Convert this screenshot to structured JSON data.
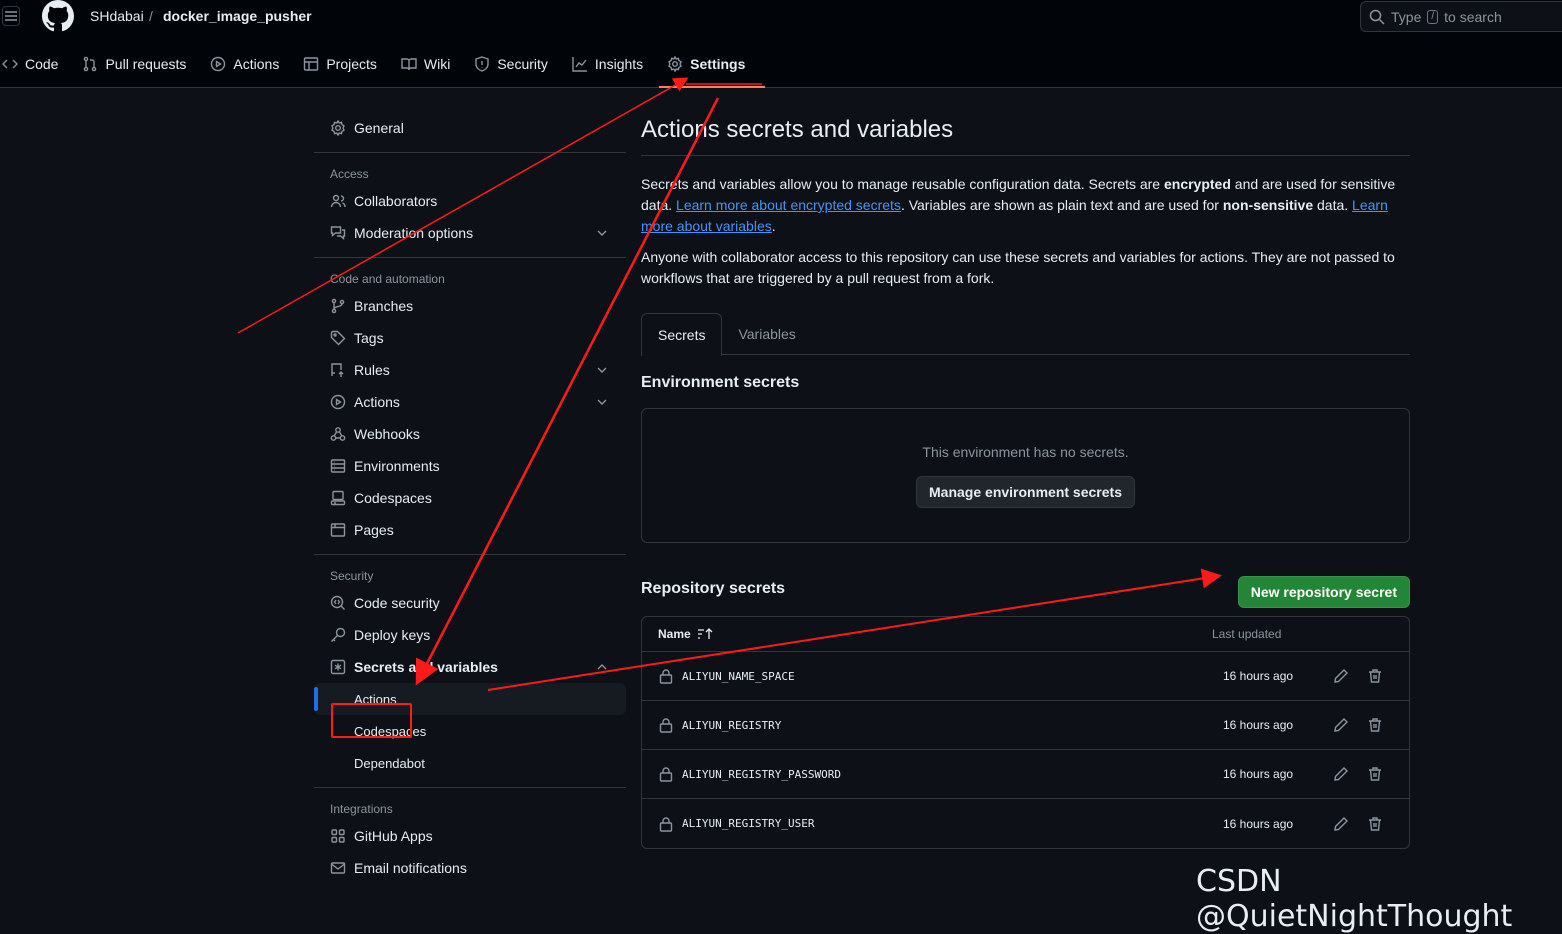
{
  "header": {
    "owner": "SHdabai",
    "separator": "/",
    "repo": "docker_image_pusher",
    "search": {
      "before": "Type",
      "key": "/",
      "after": "to search"
    }
  },
  "repo_tabs": [
    {
      "label": "Code",
      "icon": "code-icon"
    },
    {
      "label": "Pull requests",
      "icon": "pull-request-icon"
    },
    {
      "label": "Actions",
      "icon": "play-icon"
    },
    {
      "label": "Projects",
      "icon": "table-icon"
    },
    {
      "label": "Wiki",
      "icon": "book-icon"
    },
    {
      "label": "Security",
      "icon": "shield-icon"
    },
    {
      "label": "Insights",
      "icon": "graph-icon"
    },
    {
      "label": "Settings",
      "icon": "gear-icon",
      "active": true
    }
  ],
  "sidebar": {
    "general": "General",
    "access_title": "Access",
    "access": [
      "Collaborators",
      "Moderation options"
    ],
    "code_title": "Code and automation",
    "code": [
      "Branches",
      "Tags",
      "Rules",
      "Actions",
      "Webhooks",
      "Environments",
      "Codespaces",
      "Pages"
    ],
    "security_title": "Security",
    "security": [
      "Code security",
      "Deploy keys",
      "Secrets and variables"
    ],
    "secrets_sub": [
      "Actions",
      "Codespaces",
      "Dependabot"
    ],
    "integrations_title": "Integrations",
    "integrations": [
      "GitHub Apps",
      "Email notifications"
    ]
  },
  "main": {
    "title": "Actions secrets and variables",
    "intro": {
      "t1": "Secrets and variables allow you to manage reusable configuration data. Secrets are ",
      "b1": "encrypted",
      "t2": " and are used for sensitive data. ",
      "link1": "Learn more about encrypted secrets",
      "t3": ". Variables are shown as plain text and are used for ",
      "b2": "non-sensitive",
      "t4": " data. ",
      "link2": "Learn more about variables",
      "t5": "."
    },
    "access_note": "Anyone with collaborator access to this repository can use these secrets and variables for actions. They are not passed to workflows that are triggered by a pull request from a fork.",
    "tabs": [
      "Secrets",
      "Variables"
    ],
    "env_title": "Environment secrets",
    "env_empty": "This environment has no secrets.",
    "env_button": "Manage environment secrets",
    "repo_title": "Repository secrets",
    "new_button": "New repository secret",
    "table_headers": {
      "name": "Name",
      "updated": "Last updated"
    },
    "secrets": [
      {
        "name": "ALIYUN_NAME_SPACE",
        "updated": "16 hours ago"
      },
      {
        "name": "ALIYUN_REGISTRY",
        "updated": "16 hours ago"
      },
      {
        "name": "ALIYUN_REGISTRY_PASSWORD",
        "updated": "16 hours ago"
      },
      {
        "name": "ALIYUN_REGISTRY_USER",
        "updated": "16 hours ago"
      }
    ]
  },
  "watermark": "CSDN @QuietNightThought",
  "colors": {
    "accent": "#4493f8",
    "primary_button": "#238636",
    "annotation": "#ff1a1a",
    "active_underline": "#f78166"
  }
}
